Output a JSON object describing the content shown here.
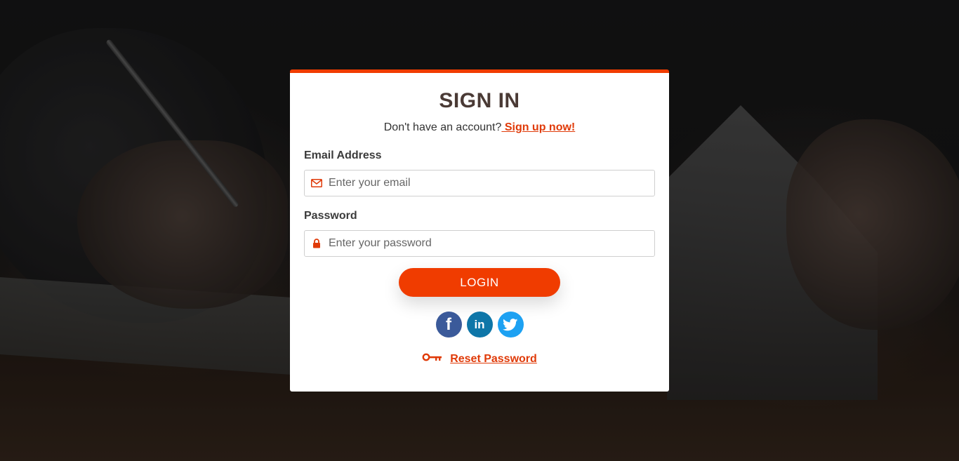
{
  "signin": {
    "title": "SIGN IN",
    "prompt": "Don't have an account?",
    "signup_link": " Sign up now!",
    "email_label": "Email Address",
    "email_placeholder": "Enter your email",
    "password_label": "Password",
    "password_placeholder": "Enter your password",
    "login_button": "LOGIN",
    "reset_link": "Reset Password"
  },
  "social": {
    "facebook_glyph": "f",
    "linkedin_glyph": "in"
  },
  "icons": {
    "email": "envelope-icon",
    "password": "lock-icon",
    "reset": "key-icon",
    "twitter": "twitter-bird-icon"
  },
  "colors": {
    "accent": "#f03c00",
    "link": "#e03a08",
    "facebook": "#3b5a9a",
    "linkedin": "#0e76a8",
    "twitter": "#1da1f2"
  }
}
